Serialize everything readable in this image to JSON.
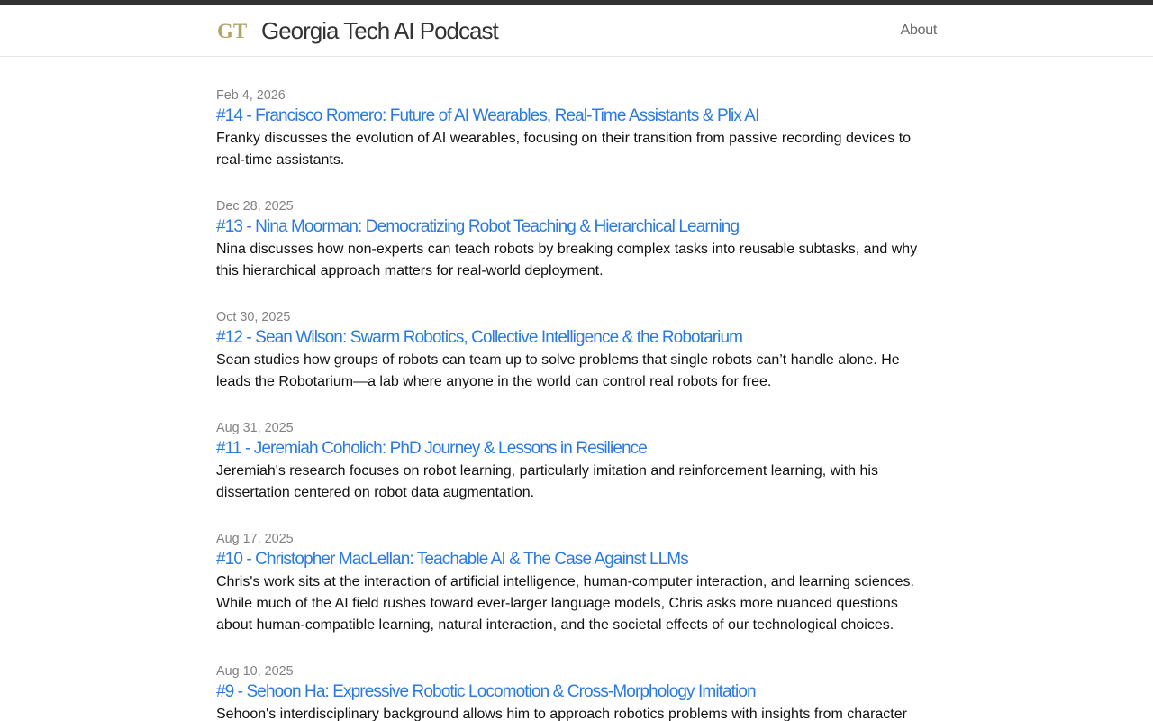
{
  "site": {
    "title": "Georgia Tech AI Podcast",
    "nav_about": "About",
    "logo_text": "GT",
    "colors": {
      "link": "#2a7ae2",
      "logo_gold": "#B3A369",
      "topbar": "#333333",
      "meta": "#828282"
    }
  },
  "posts": [
    {
      "date": "Feb 4, 2026",
      "title": "#14 - Francisco Romero: Future of AI Wearables, Real-Time Assistants & Plix AI",
      "excerpt": "Franky discusses the evolution of AI wearables, focusing on their transition from passive recording devices to real-time assistants."
    },
    {
      "date": "Dec 28, 2025",
      "title": "#13 - Nina Moorman: Democratizing Robot Teaching & Hierarchical Learning",
      "excerpt": "Nina discusses how non-experts can teach robots by breaking complex tasks into reusable subtasks, and why this hierarchical approach matters for real-world deployment."
    },
    {
      "date": "Oct 30, 2025",
      "title": "#12 - Sean Wilson: Swarm Robotics, Collective Intelligence & the Robotarium",
      "excerpt": "Sean studies how groups of robots can team up to solve problems that single robots can’t handle alone. He leads the Robotarium—a lab where anyone in the world can control real robots for free."
    },
    {
      "date": "Aug 31, 2025",
      "title": "#11 - Jeremiah Coholich: PhD Journey & Lessons in Resilience",
      "excerpt": "Jeremiah's research focuses on robot learning, particularly imitation and reinforcement learning, with his dissertation centered on robot data augmentation."
    },
    {
      "date": "Aug 17, 2025",
      "title": "#10 - Christopher MacLellan: Teachable AI & The Case Against LLMs",
      "excerpt": "Chris's work sits at the interaction of artificial intelligence, human-computer interaction, and learning sciences. While much of the AI field rushes toward ever-larger language models, Chris asks more nuanced questions about human-compatible learning, natural interaction, and the societal effects of our technological choices."
    },
    {
      "date": "Aug 10, 2025",
      "title": "#9 - Sehoon Ha: Expressive Robotic Locomotion & Cross-Morphology Imitation",
      "excerpt": "Sehoon's interdisciplinary background allows him to approach robotics problems with insights from character"
    }
  ]
}
